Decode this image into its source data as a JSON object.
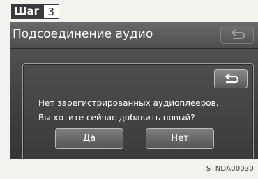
{
  "step": {
    "word": "Шаг",
    "number": "3"
  },
  "screen": {
    "title": "Подсоединение аудио",
    "header_back_icon": "return-arrow-icon"
  },
  "dialog": {
    "back_icon": "return-arrow-icon",
    "message_line1": "Нет зарегистрированных аудиоплееров.",
    "message_line2": "Вы хотите сейчас добавить новый?",
    "yes_label": "Да",
    "no_label": "Нет"
  },
  "caption": "STNDA00030"
}
